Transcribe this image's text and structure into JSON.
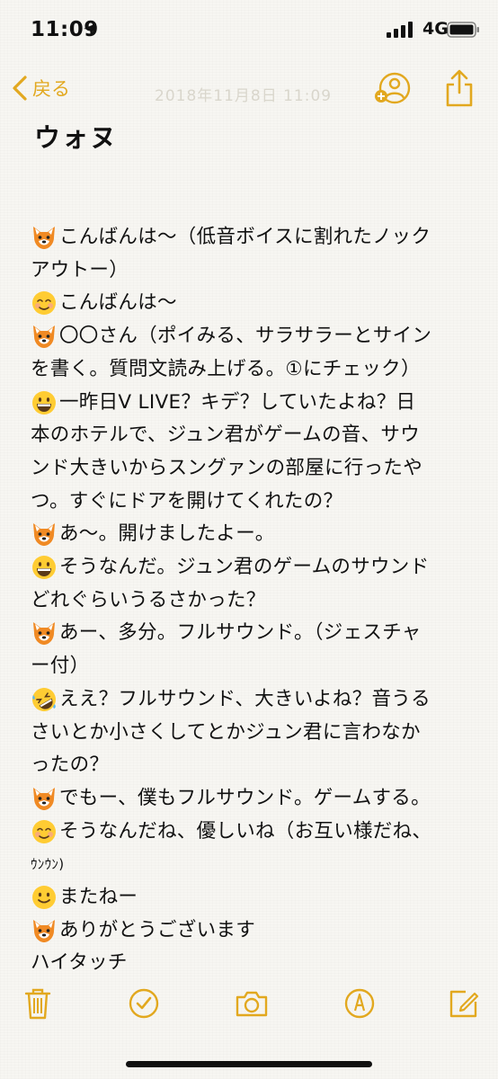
{
  "status": {
    "time": "11:09",
    "network": "4G"
  },
  "nav": {
    "back_label": "戻る",
    "date_faded": "2018年11月8日 11:09"
  },
  "note": {
    "title": "ウォヌ",
    "lines": [
      {
        "emoji": "fox",
        "text": "こんばんは〜（低音ボイスに割れたノック"
      },
      {
        "emoji": "",
        "text": "アウトー）"
      },
      {
        "emoji": "smiling",
        "text": "こんばんは〜"
      },
      {
        "emoji": "fox",
        "text": "〇〇さん（ポイみる、サラサラーとサイン"
      },
      {
        "emoji": "",
        "text": "を書く。質問文読み上げる。①にチェック）"
      },
      {
        "emoji": "grin",
        "text": "一昨日V LIVE？キデ？していたよね？日"
      },
      {
        "emoji": "",
        "text": "本のホテルで、ジュン君がゲームの音、サウ"
      },
      {
        "emoji": "",
        "text": "ンド大きいからスングァンの部屋に行ったや"
      },
      {
        "emoji": "",
        "text": "つ。すぐにドアを開けてくれたの？"
      },
      {
        "emoji": "fox",
        "text": "あ〜。開けましたよー。"
      },
      {
        "emoji": "grin",
        "text": "そうなんだ。ジュン君のゲームのサウンド"
      },
      {
        "emoji": "",
        "text": "どれぐらいうるさかった？"
      },
      {
        "emoji": "fox",
        "text": "あー、多分。フルサウンド。（ジェスチャ"
      },
      {
        "emoji": "",
        "text": "ー付）"
      },
      {
        "emoji": "rofl",
        "text": "ええ？フルサウンド、大きいよね？音うる"
      },
      {
        "emoji": "",
        "text": "さいとか小さくしてとかジュン君に言わなか"
      },
      {
        "emoji": "",
        "text": "ったの？"
      },
      {
        "emoji": "fox",
        "text": "でもー、僕もフルサウンド。ゲームする。"
      },
      {
        "emoji": "smiling",
        "text": "そうなんだね、優しいね（お互い様だね、"
      },
      {
        "emoji": "",
        "text": "ｳﾝｳﾝ)",
        "small": true
      },
      {
        "emoji": "slight",
        "text": "またねー"
      },
      {
        "emoji": "fox",
        "text": "ありがとうございます"
      },
      {
        "emoji": "",
        "text": "ハイタッチ"
      }
    ]
  },
  "toolbar": {
    "items": [
      "trash-icon",
      "checklist-icon",
      "camera-icon",
      "markup-icon",
      "compose-icon"
    ]
  },
  "colors": {
    "accent": "#e2a81f",
    "paper": "#f7f6f2",
    "text": "#111111"
  }
}
